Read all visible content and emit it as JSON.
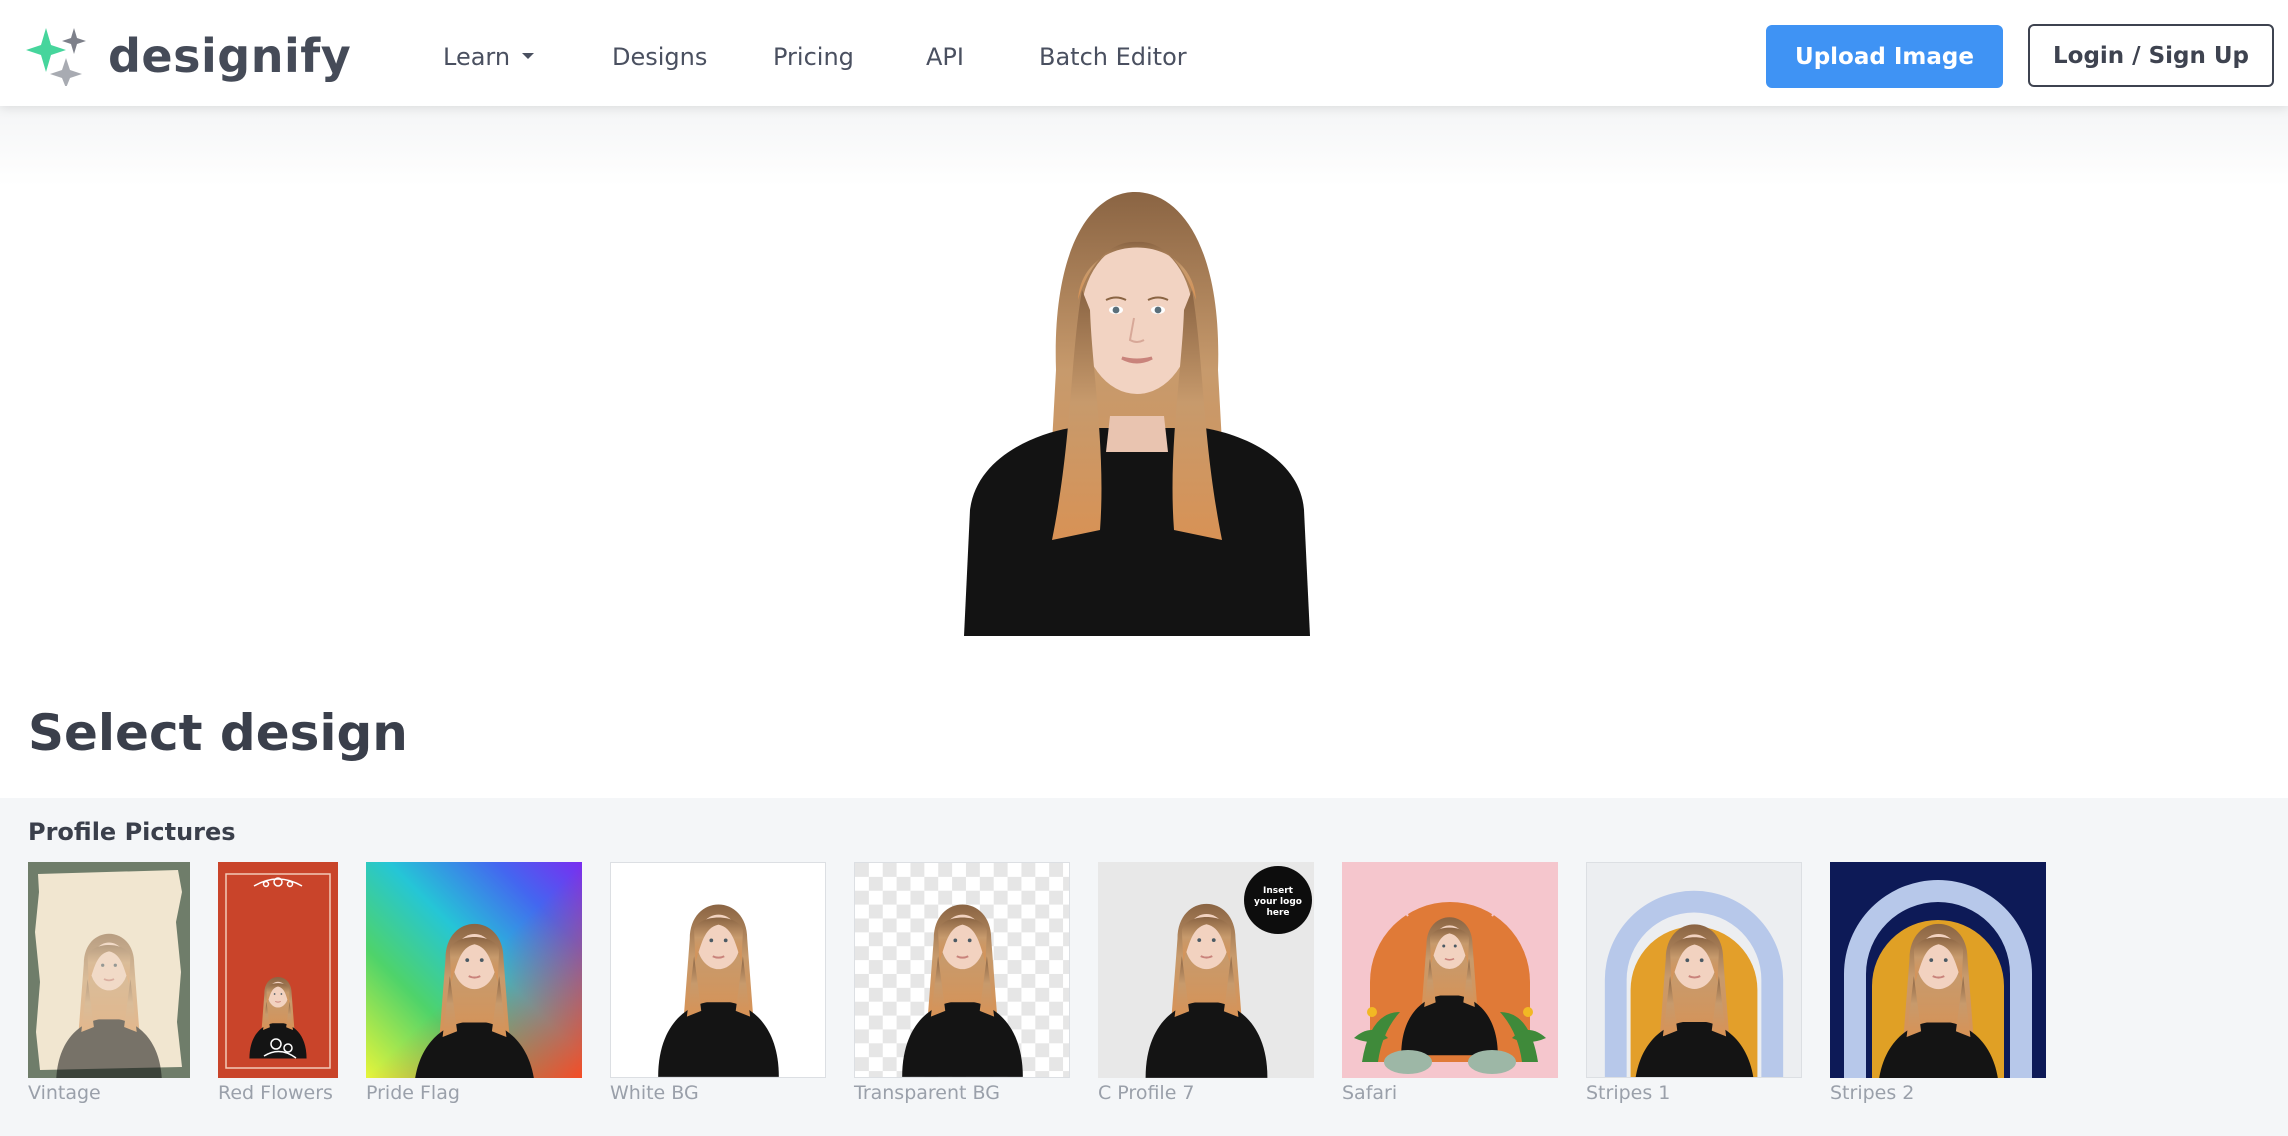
{
  "header": {
    "brand": "designify",
    "nav": [
      {
        "label": "Learn",
        "has_dropdown": true
      },
      {
        "label": "Designs"
      },
      {
        "label": "Pricing"
      },
      {
        "label": "API"
      },
      {
        "label": "Batch Editor"
      }
    ],
    "upload_label": "Upload Image",
    "login_label": "Login / Sign Up"
  },
  "colors": {
    "accent_blue": "#3f93f4",
    "logo_green": "#46d59c",
    "logo_grey": "#7d808a",
    "text_dark": "#3a3f4b"
  },
  "main": {
    "section_title": "Select design",
    "category": "Profile Pictures",
    "designs": [
      {
        "name": "Vintage",
        "icon": "vintage-frame"
      },
      {
        "name": "Red Flowers",
        "icon": "red-flowers"
      },
      {
        "name": "Pride Flag",
        "icon": "rainbow-gradient"
      },
      {
        "name": "White BG",
        "icon": "white-bg"
      },
      {
        "name": "Transparent BG",
        "icon": "checkerboard"
      },
      {
        "name": "C Profile 7",
        "icon": "logo-badge",
        "badge_text": "Insert your logo here"
      },
      {
        "name": "Safari",
        "icon": "safari"
      },
      {
        "name": "Stripes 1",
        "icon": "arch-light"
      },
      {
        "name": "Stripes 2",
        "icon": "arch-navy"
      }
    ]
  }
}
